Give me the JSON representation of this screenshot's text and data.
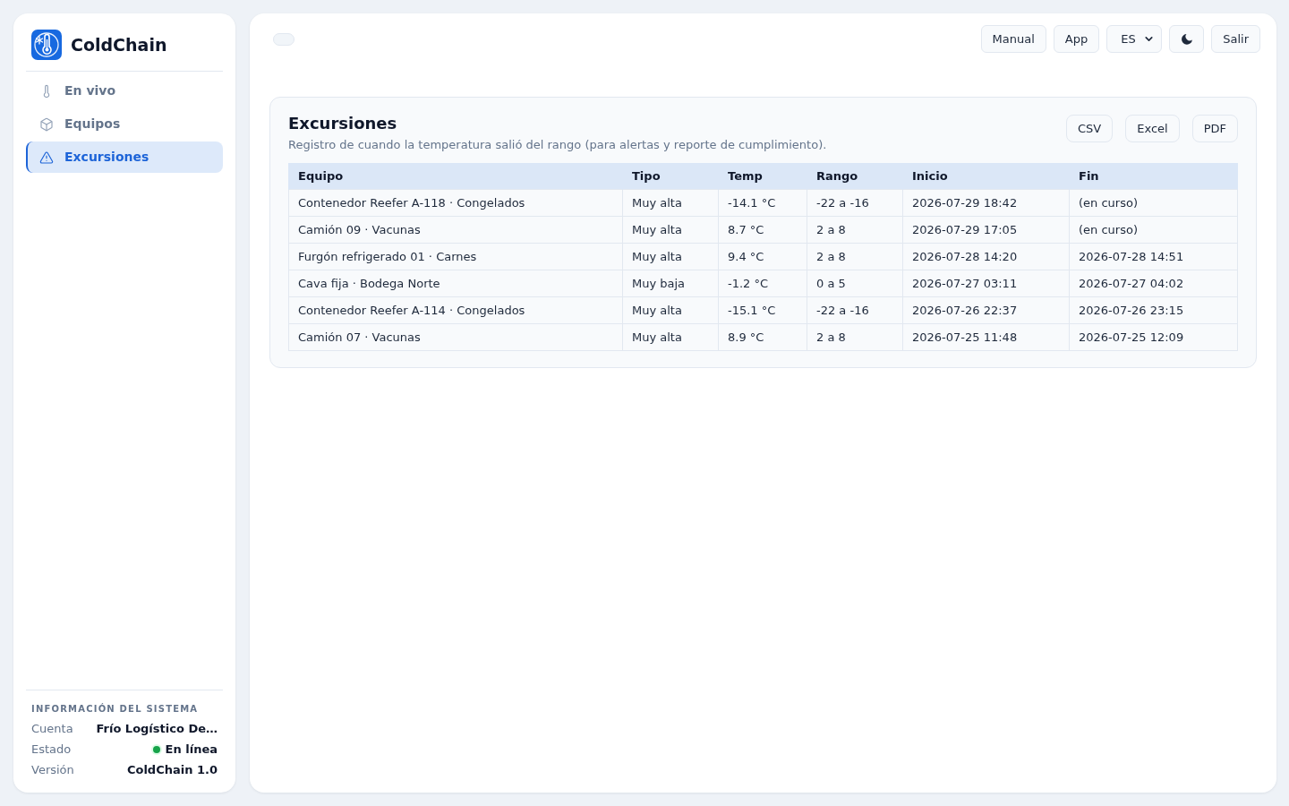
{
  "sidebar": {
    "brand": "ColdChain",
    "nav": [
      {
        "label": "En vivo",
        "selected": false
      },
      {
        "label": "Equipos",
        "selected": false
      },
      {
        "label": "Excursiones",
        "selected": true
      }
    ],
    "system_info": {
      "heading": "INFORMACIÓN DEL SISTEMA",
      "rows": [
        {
          "label": "Cuenta",
          "value": "Frío Logístico De…",
          "kind": "text"
        },
        {
          "label": "Estado",
          "value": "En línea",
          "kind": "status",
          "online": true
        },
        {
          "label": "Versión",
          "value": "ColdChain 1.0",
          "kind": "text"
        }
      ]
    }
  },
  "topbar": {
    "toggle": {
      "on": false
    },
    "links": [
      "Manual",
      "App"
    ],
    "language": "ES",
    "exit": "Salir"
  },
  "card": {
    "title": "Excursiones",
    "subtitle": "Registro de cuando la temperatura salió del rango (para alertas y reporte de cumplimiento).",
    "exports": [
      "CSV",
      "Excel",
      "PDF"
    ],
    "table": {
      "columns": [
        "Equipo",
        "Tipo",
        "Temp",
        "Rango",
        "Inicio",
        "Fin"
      ],
      "rows": [
        [
          "Contenedor Reefer A-118 · Congelados",
          "Muy alta",
          "-14.1 °C",
          "-22 a -16",
          "2026-07-29 18:42",
          "(en curso)"
        ],
        [
          "Camión 09 · Vacunas",
          "Muy alta",
          "8.7 °C",
          "2 a 8",
          "2026-07-29 17:05",
          "(en curso)"
        ],
        [
          "Furgón refrigerado 01 · Carnes",
          "Muy alta",
          "9.4 °C",
          "2 a 8",
          "2026-07-28 14:20",
          "2026-07-28 14:51"
        ],
        [
          "Cava fija · Bodega Norte",
          "Muy baja",
          "-1.2 °C",
          "0 a 5",
          "2026-07-27 03:11",
          "2026-07-27 04:02"
        ],
        [
          "Contenedor Reefer A-114 · Congelados",
          "Muy alta",
          "-15.1 °C",
          "-22 a -16",
          "2026-07-26 22:37",
          "2026-07-26 23:15"
        ],
        [
          "Camión 07 · Vacunas",
          "Muy alta",
          "8.9 °C",
          "2 a 8",
          "2026-07-25 11:48",
          "2026-07-25 12:09"
        ]
      ]
    }
  }
}
